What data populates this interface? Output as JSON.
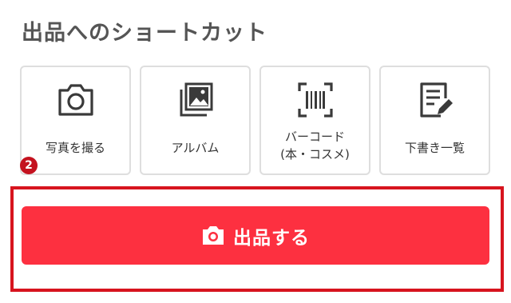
{
  "section": {
    "title": "出品へのショートカット"
  },
  "shortcuts": [
    {
      "label": "写真を撮る",
      "icon": "camera-icon"
    },
    {
      "label": "アルバム",
      "icon": "photo-album-icon"
    },
    {
      "label_line1": "バーコード",
      "label_line2": "(本・コスメ)",
      "icon": "barcode-scan-icon"
    },
    {
      "label": "下書き一覧",
      "icon": "draft-document-icon"
    }
  ],
  "annotation_badge": "2",
  "primary_button": {
    "label": "出品する",
    "icon": "camera-icon"
  },
  "colors": {
    "primary_button_bg": "#fd3040",
    "highlight_frame": "#d7141e",
    "badge_bg": "#c4121f",
    "title_text": "#555555",
    "card_border": "#dedede"
  }
}
